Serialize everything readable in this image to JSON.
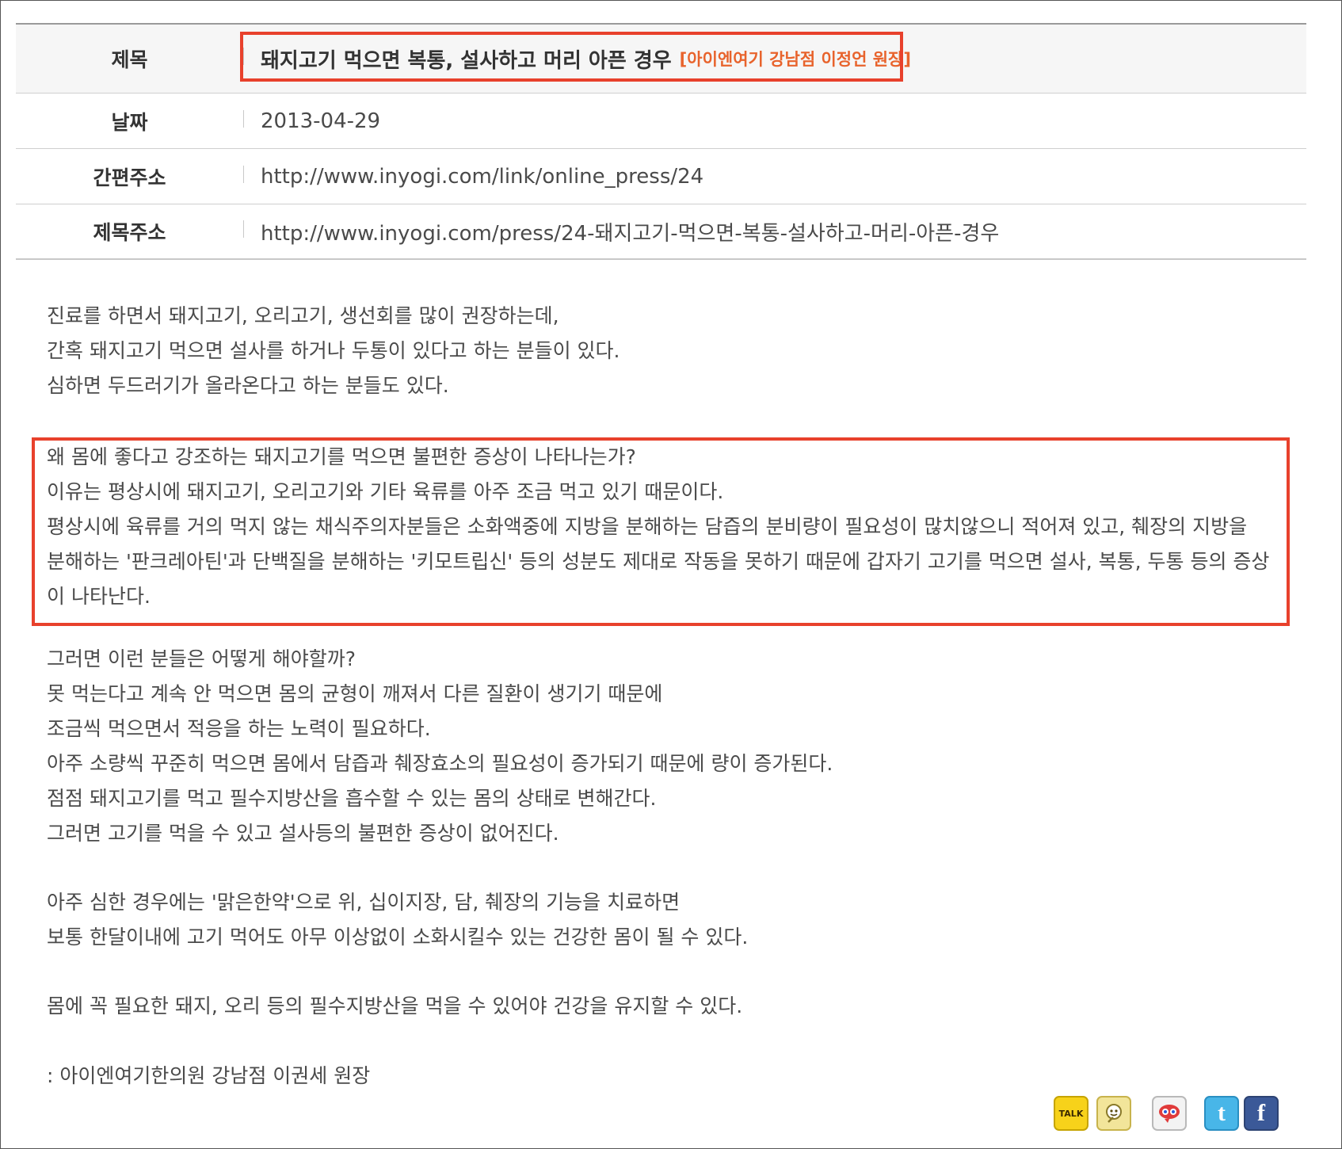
{
  "info": {
    "rows": [
      {
        "label": "제목",
        "title": "돼지고기 먹으면 복통, 설사하고 머리 아픈 경우",
        "author": "[아이엔여기 강남점 이정언 원장]"
      },
      {
        "label": "날짜",
        "value": "2013-04-29"
      },
      {
        "label": "간편주소",
        "value": "http://www.inyogi.com/link/online_press/24"
      },
      {
        "label": "제목주소",
        "value": "http://www.inyogi.com/press/24-돼지고기-먹으면-복통-설사하고-머리-아픈-경우"
      }
    ]
  },
  "body": {
    "p1": [
      "진료를 하면서 돼지고기, 오리고기, 생선회를 많이 권장하는데,",
      "간혹 돼지고기 먹으면 설사를 하거나 두통이 있다고 하는 분들이 있다.",
      "심하면 두드러기가 올라온다고 하는 분들도 있다."
    ],
    "p2": [
      "왜 몸에 좋다고 강조하는 돼지고기를 먹으면 불편한 증상이 나타나는가?",
      "이유는 평상시에 돼지고기, 오리고기와 기타 육류를 아주 조금 먹고 있기 때문이다.",
      "평상시에 육류를 거의 먹지 않는 채식주의자분들은 소화액중에 지방을 분해하는 담즙의 분비량이 필요성이 많치않으니 적어져 있고, 췌장의 지방을 분해하는 '판크레아틴'과 단백질을 분해하는 '키모트립신' 등의 성분도 제대로 작동을 못하기 때문에 갑자기 고기를 먹으면 설사, 복통, 두통 등의 증상이 나타난다."
    ],
    "p3": [
      "그러면 이런 분들은 어떻게 해야할까?",
      "못 먹는다고 계속 안 먹으면 몸의 균형이 깨져서 다른 질환이 생기기 때문에",
      "조금씩 먹으면서 적응을 하는 노력이 필요하다.",
      "아주 소량씩 꾸준히 먹으면 몸에서 담즙과 췌장효소의 필요성이 증가되기 때문에 량이 증가된다.",
      "점점 돼지고기를 먹고 필수지방산을 흡수할 수 있는 몸의 상태로 변해간다.",
      "그러면 고기를 먹을 수 있고 설사등의 불편한 증상이 없어진다."
    ],
    "p4": [
      "아주 심한 경우에는 '맑은한약'으로 위, 십이지장, 담, 췌장의 기능을 치료하면",
      "보통 한달이내에 고기 먹어도 아무 이상없이 소화시킬수 있는 건강한 몸이 될 수 있다."
    ],
    "p5": [
      "몸에 꼭 필요한 돼지, 오리 등의 필수지방산을 먹을 수 있어야 건강을 유지할 수 있다."
    ],
    "signature": ": 아이엔여기한의원 강남점 이권세 원장"
  },
  "social": {
    "talk_label": "TALK",
    "twitter_glyph": "t",
    "facebook_glyph": "f",
    "icons": [
      "kakaotalk-icon",
      "me2day-icon",
      "yozm-icon",
      "twitter-icon",
      "facebook-icon"
    ]
  }
}
